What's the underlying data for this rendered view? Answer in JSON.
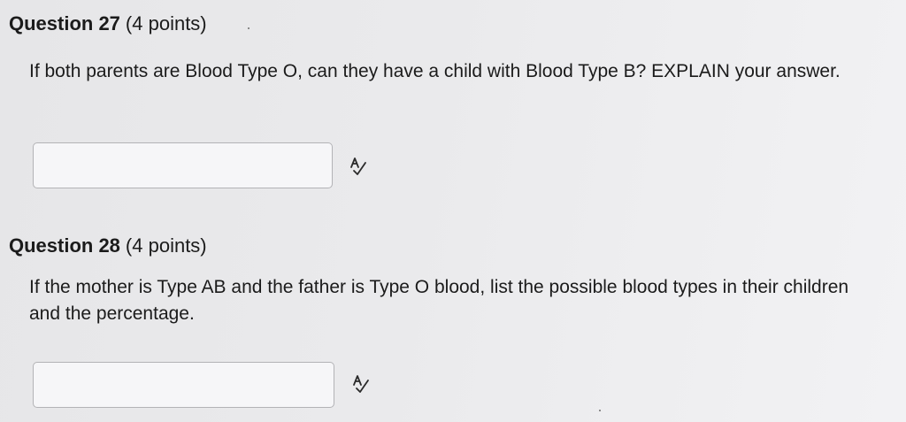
{
  "questions": [
    {
      "title": "Question 27",
      "points": "(4 points)",
      "prompt": "If both parents are Blood Type O, can they have a child with Blood Type B? EXPLAIN your answer.",
      "answer_value": "",
      "spellcheck_icon": "spellcheck-icon"
    },
    {
      "title": "Question 28",
      "points": "(4 points)",
      "prompt": "If the mother is Type AB and the father is Type O blood, list the possible blood types in their children and the percentage.",
      "answer_value": "",
      "spellcheck_icon": "spellcheck-icon"
    }
  ]
}
